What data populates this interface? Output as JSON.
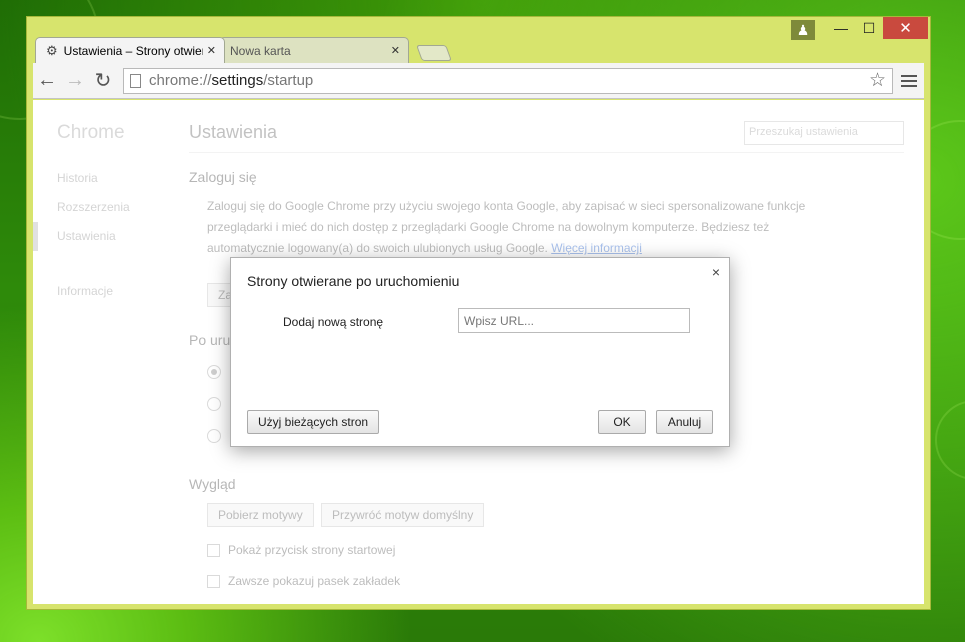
{
  "window": {
    "controls": {
      "user_icon": "user-icon",
      "minimize": "—",
      "maximize": "☐",
      "close": "✕"
    }
  },
  "tabs": [
    {
      "title": "Ustawienia – Strony otwierane po uruchomieniu",
      "icon": "gear-icon",
      "active": true
    },
    {
      "title": "Nowa karta",
      "icon": "",
      "active": false
    }
  ],
  "omnibox": {
    "scheme": "chrome://",
    "path": "settings",
    "rest": "/startup"
  },
  "page": {
    "brand": "Chrome",
    "sidebar": [
      {
        "label": "Historia"
      },
      {
        "label": "Rozszerzenia"
      },
      {
        "label": "Ustawienia"
      },
      {
        "label": "Informacje"
      }
    ],
    "title": "Ustawienia",
    "search_placeholder": "Przeszukaj ustawienia",
    "signin": {
      "heading": "Zaloguj się",
      "text": "Zaloguj się do Google Chrome przy użyciu swojego konta Google, aby zapisać w sieci spersonalizowane funkcje przeglądarki i mieć do nich dostęp z przeglądarki Google Chrome na dowolnym komputerze. Będziesz też automatycznie logowany(a) do swoich ulubionych usług Google. ",
      "link": "Więcej informacji",
      "button_fragment": "Za"
    },
    "startup": {
      "heading_fragment": "Po uru"
    },
    "appearance": {
      "heading": "Wygląd",
      "get_themes": "Pobierz motywy",
      "reset_theme": "Przywróć motyw domyślny",
      "show_home": "Pokaż przycisk strony startowej",
      "show_bookmarks": "Zawsze pokazuj pasek zakładek"
    }
  },
  "dialog": {
    "title": "Strony otwierane po uruchomieniu",
    "add_label": "Dodaj nową stronę",
    "url_placeholder": "Wpisz URL...",
    "use_current": "Użyj bieżących stron",
    "ok": "OK",
    "cancel": "Anuluj",
    "close": "×"
  }
}
